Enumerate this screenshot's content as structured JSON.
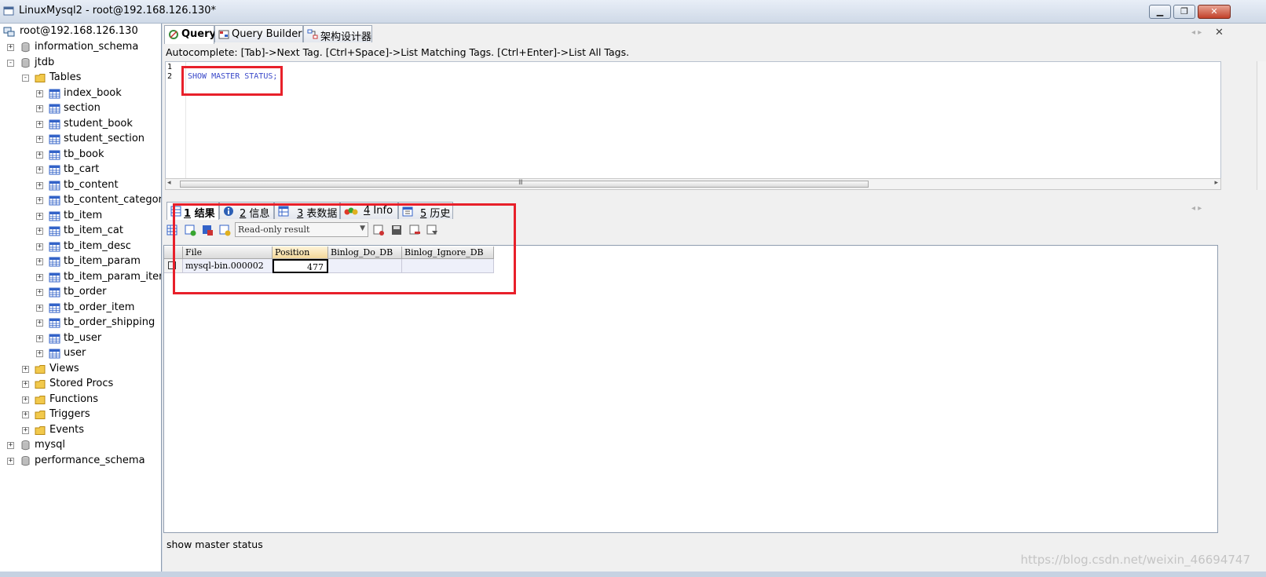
{
  "window": {
    "title": "LinuxMysql2 - root@192.168.126.130*"
  },
  "tree": {
    "connection": "root@192.168.126.130",
    "nodes": [
      {
        "label": "information_schema",
        "level": 1,
        "kind": "db",
        "exp": "+"
      },
      {
        "label": "jtdb",
        "level": 1,
        "kind": "db",
        "exp": "-"
      },
      {
        "label": "Tables",
        "level": 2,
        "kind": "folder",
        "exp": "-"
      },
      {
        "label": "index_book",
        "level": 3,
        "kind": "table",
        "exp": "+"
      },
      {
        "label": "section",
        "level": 3,
        "kind": "table",
        "exp": "+"
      },
      {
        "label": "student_book",
        "level": 3,
        "kind": "table",
        "exp": "+"
      },
      {
        "label": "student_section",
        "level": 3,
        "kind": "table",
        "exp": "+"
      },
      {
        "label": "tb_book",
        "level": 3,
        "kind": "table",
        "exp": "+"
      },
      {
        "label": "tb_cart",
        "level": 3,
        "kind": "table",
        "exp": "+"
      },
      {
        "label": "tb_content",
        "level": 3,
        "kind": "table",
        "exp": "+"
      },
      {
        "label": "tb_content_category",
        "level": 3,
        "kind": "table",
        "exp": "+"
      },
      {
        "label": "tb_item",
        "level": 3,
        "kind": "table",
        "exp": "+"
      },
      {
        "label": "tb_item_cat",
        "level": 3,
        "kind": "table",
        "exp": "+"
      },
      {
        "label": "tb_item_desc",
        "level": 3,
        "kind": "table",
        "exp": "+"
      },
      {
        "label": "tb_item_param",
        "level": 3,
        "kind": "table",
        "exp": "+"
      },
      {
        "label": "tb_item_param_item",
        "level": 3,
        "kind": "table",
        "exp": "+"
      },
      {
        "label": "tb_order",
        "level": 3,
        "kind": "table",
        "exp": "+"
      },
      {
        "label": "tb_order_item",
        "level": 3,
        "kind": "table",
        "exp": "+"
      },
      {
        "label": "tb_order_shipping",
        "level": 3,
        "kind": "table",
        "exp": "+"
      },
      {
        "label": "tb_user",
        "level": 3,
        "kind": "table",
        "exp": "+"
      },
      {
        "label": "user",
        "level": 3,
        "kind": "table",
        "exp": "+"
      },
      {
        "label": "Views",
        "level": 2,
        "kind": "folder",
        "exp": "+"
      },
      {
        "label": "Stored Procs",
        "level": 2,
        "kind": "folder",
        "exp": "+"
      },
      {
        "label": "Functions",
        "level": 2,
        "kind": "folder",
        "exp": "+"
      },
      {
        "label": "Triggers",
        "level": 2,
        "kind": "folder",
        "exp": "+"
      },
      {
        "label": "Events",
        "level": 2,
        "kind": "folder",
        "exp": "+"
      },
      {
        "label": "mysql",
        "level": 1,
        "kind": "db",
        "exp": "+"
      },
      {
        "label": "performance_schema",
        "level": 1,
        "kind": "db",
        "exp": "+"
      }
    ]
  },
  "editor_tabs": {
    "query": "Query",
    "builder": "Query Builder",
    "schema": "架构设计器"
  },
  "autocomplete_hint": "Autocomplete: [Tab]->Next Tag. [Ctrl+Space]->List Matching Tags. [Ctrl+Enter]->List All Tags.",
  "editor": {
    "line1": "1",
    "line2": "2",
    "sql": "SHOW MASTER STATUS;",
    "hscroll_marks": "III"
  },
  "result_tabs": {
    "t1_num": "1",
    "t1_label": "结果",
    "t2_num": "2",
    "t2_label": "信息",
    "t3_num": "3",
    "t3_label": "表数据",
    "t4_num": "4",
    "t4_label": "Info",
    "t5_num": "5",
    "t5_label": "历史"
  },
  "result_toolbar": {
    "mode": "Read-only result"
  },
  "grid": {
    "columns": [
      "File",
      "Position",
      "Binlog_Do_DB",
      "Binlog_Ignore_DB"
    ],
    "rows": [
      [
        "mysql-bin.000002",
        "477",
        "",
        ""
      ]
    ]
  },
  "status_text": "show master status",
  "watermark": "https://blog.csdn.net/weixin_46694747",
  "colors": {
    "highlight_box": "#e8202a",
    "sql_text": "#3a49c9"
  }
}
